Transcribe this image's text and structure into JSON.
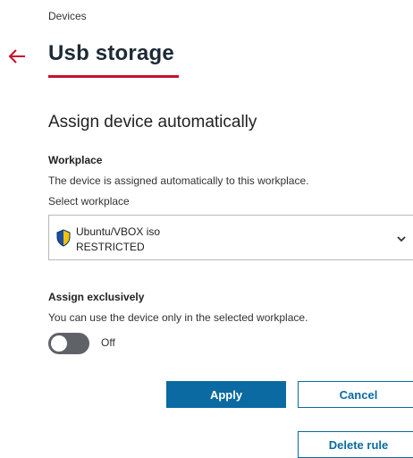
{
  "breadcrumb": "Devices",
  "title": "Usb storage",
  "section_title": "Assign device automatically",
  "workplace": {
    "label": "Workplace",
    "description": "The device is assigned automatically to this workplace.",
    "select_label": "Select workplace",
    "selected": {
      "name": "Ubuntu/VBOX iso",
      "status": "RESTRICTED",
      "icon": "shield-icon"
    }
  },
  "exclusive": {
    "label": "Assign exclusively",
    "description": "You can use the device only in the selected workplace.",
    "toggle_state": "Off"
  },
  "buttons": {
    "apply": "Apply",
    "cancel": "Cancel",
    "delete": "Delete rule"
  },
  "colors": {
    "accent_red": "#c8102e",
    "primary_blue": "#0a6aa1",
    "title_navy": "#1d2a36",
    "toggle_off": "#5f6368"
  }
}
